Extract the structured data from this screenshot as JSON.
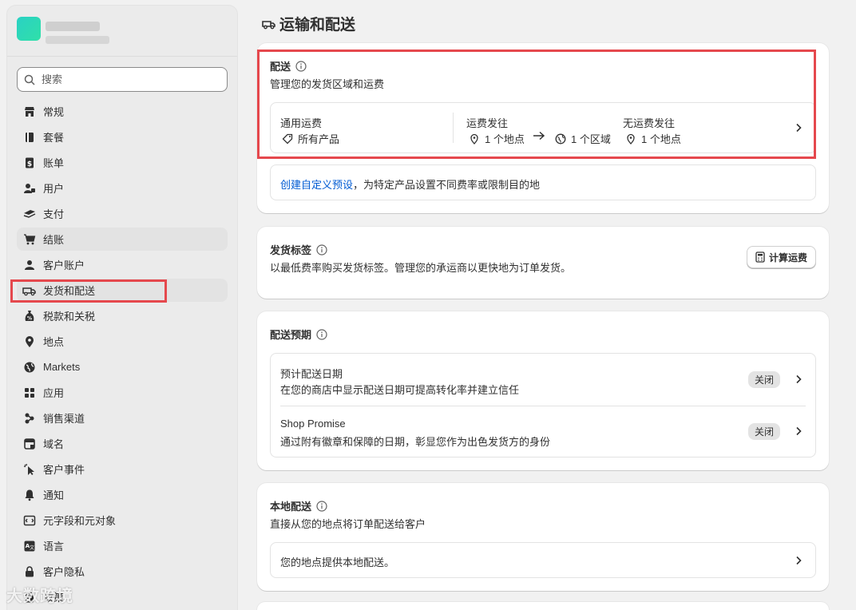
{
  "sidebar": {
    "search_placeholder": "搜索",
    "items": [
      {
        "label": "常规",
        "icon": "store-icon"
      },
      {
        "label": "套餐",
        "icon": "plan-icon"
      },
      {
        "label": "账单",
        "icon": "billing-icon"
      },
      {
        "label": "用户",
        "icon": "users-icon"
      },
      {
        "label": "支付",
        "icon": "payments-icon"
      },
      {
        "label": "结账",
        "icon": "cart-icon"
      },
      {
        "label": "客户账户",
        "icon": "person-icon"
      },
      {
        "label": "发货和配送",
        "icon": "truck-icon"
      },
      {
        "label": "税款和关税",
        "icon": "tax-icon"
      },
      {
        "label": "地点",
        "icon": "location-icon"
      },
      {
        "label": "Markets",
        "icon": "globe-icon"
      },
      {
        "label": "应用",
        "icon": "apps-icon"
      },
      {
        "label": "销售渠道",
        "icon": "channels-icon"
      },
      {
        "label": "域名",
        "icon": "domain-icon"
      },
      {
        "label": "客户事件",
        "icon": "cursor-icon"
      },
      {
        "label": "通知",
        "icon": "bell-icon"
      },
      {
        "label": "元字段和元对象",
        "icon": "metafields-icon"
      },
      {
        "label": "语言",
        "icon": "language-icon"
      },
      {
        "label": "客户隐私",
        "icon": "lock-icon"
      },
      {
        "label": "政策",
        "icon": "policy-icon"
      }
    ]
  },
  "page": {
    "title": "运输和配送"
  },
  "shipping": {
    "title": "配送",
    "desc": "管理您的发货区域和运费",
    "general_rates_label": "通用运费",
    "all_products": "所有产品",
    "ship_from_label": "运费发往",
    "one_location": "1 个地点",
    "one_zone": "1 个区域",
    "free_ship_label": "无运费发往",
    "free_one_location": "1 个地点",
    "custom_link": "创建自定义预设",
    "custom_rest": "，为特定产品设置不同费率或限制目的地"
  },
  "labels_card": {
    "title": "发货标签",
    "desc": "以最低费率购买发货标签。管理您的承运商以更快地为订单发货。",
    "button": "计算运费"
  },
  "delivery_expectations": {
    "title": "配送预期",
    "rows": [
      {
        "title": "预计配送日期",
        "desc": "在您的商店中显示配送日期可提高转化率并建立信任",
        "status": "关闭"
      },
      {
        "title": "Shop Promise",
        "desc": "通过附有徽章和保障的日期，彰显您作为出色发货方的身份",
        "status": "关闭"
      }
    ]
  },
  "local_delivery": {
    "title": "本地配送",
    "desc": "直接从您的地点将订单配送给客户",
    "row": "您的地点提供本地配送。"
  },
  "watermark": "大数跨境"
}
